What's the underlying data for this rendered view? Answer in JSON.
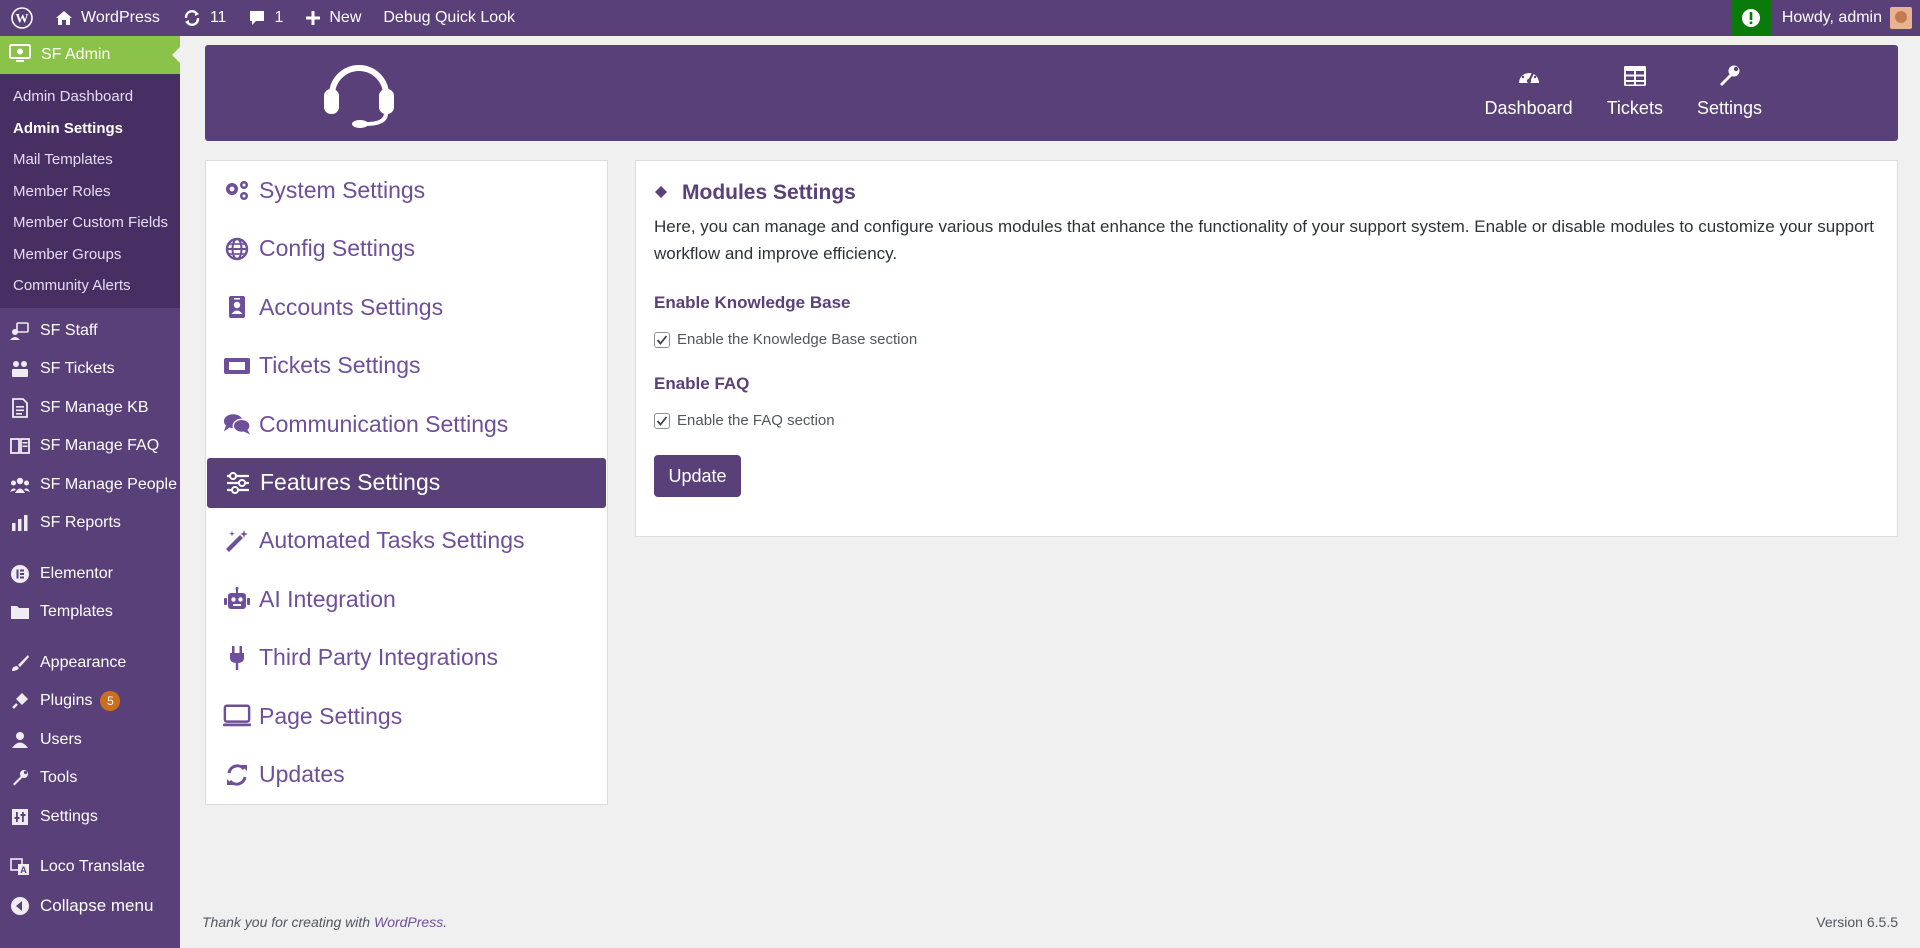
{
  "adminbar": {
    "site_name": "WordPress",
    "updates_count": "11",
    "comments_count": "1",
    "new_label": "New",
    "debug_label": "Debug Quick Look",
    "howdy": "Howdy, admin"
  },
  "sidebar": {
    "current": "SF Admin",
    "submenu": [
      "Admin Dashboard",
      "Admin Settings",
      "Mail Templates",
      "Member Roles",
      "Member Custom Fields",
      "Member Groups",
      "Community Alerts"
    ],
    "items1": [
      "SF Staff",
      "SF Tickets",
      "SF Manage KB",
      "SF Manage FAQ",
      "SF Manage People",
      "SF Reports"
    ],
    "items2": [
      "Elementor",
      "Templates"
    ],
    "items3": [
      "Appearance",
      "Plugins",
      "Users",
      "Tools",
      "Settings"
    ],
    "plugins_badge": "5",
    "items4": [
      "Loco Translate"
    ],
    "collapse": "Collapse menu"
  },
  "hero": {
    "nav": [
      "Dashboard",
      "Tickets",
      "Settings"
    ]
  },
  "settings_menu": [
    "System Settings",
    "Config Settings",
    "Accounts Settings",
    "Tickets Settings",
    "Communication Settings",
    "Features Settings",
    "Automated Tasks Settings",
    "AI Integration",
    "Third Party Integrations",
    "Page Settings",
    "Updates"
  ],
  "main": {
    "title": "Modules Settings",
    "description": "Here, you can manage and configure various modules that enhance the functionality of your support system. Enable or disable modules to customize your support workflow and improve efficiency.",
    "kb_label": "Enable Knowledge Base",
    "kb_checkbox": "Enable the Knowledge Base section",
    "faq_label": "Enable FAQ",
    "faq_checkbox": "Enable the FAQ section",
    "update_button": "Update"
  },
  "footer": {
    "thanks": "Thank you for creating with ",
    "wp_link": "WordPress",
    "period": ".",
    "version": "Version 6.5.5"
  },
  "colors": {
    "brand": "#5a4079",
    "accent": "#8bc34a",
    "link": "#6e4f9a"
  }
}
